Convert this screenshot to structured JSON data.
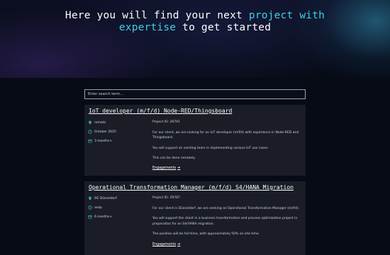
{
  "hero": {
    "title_part1": "Here you will find your next ",
    "title_highlight1": "project with",
    "title_highlight2": "expertise",
    "title_part2": " to get started"
  },
  "search": {
    "placeholder": "Enter search term..."
  },
  "colors": {
    "accent": "#3fd0e6",
    "card_bg": "#1a1d26",
    "page_bg": "#070b16"
  },
  "jobs": [
    {
      "title": "IoT developer (m/f/d) Node-RED/Thingsboard",
      "location": "remote",
      "start": "October 2025",
      "duration": "3 months+",
      "project_id": "Project ID: 29791",
      "paragraphs": [
        "For our client, we are looking for an IoT developer (m/f/d) with experience in Node-RED and Thingsboard.",
        "You will support an existing team in implementing various IoT use cases.",
        "This can be done remotely."
      ],
      "apply_label": "Engagements",
      "icons": {
        "location": "pin-icon",
        "start": "clock-icon",
        "duration": "calendar-icon"
      }
    },
    {
      "title": "Operational Transformation Manager (m/f/d) S4/HANA Migration",
      "location": "DE Düsseldorf",
      "start": "asap",
      "duration": "6 months+",
      "project_id": "Project ID: 29787",
      "paragraphs": [
        "For our client in Düsseldorf, we are seeking an Operational Transformation Manager (m/f/d).",
        "You will support the client in a business transformation and process optimization project in preparation for an S4/HANA migration.",
        "The position will be full-time, with approximately 50% on-site time."
      ],
      "apply_label": "Engagements",
      "icons": {
        "location": "pin-icon",
        "start": "clock-icon",
        "duration": "calendar-icon"
      }
    }
  ]
}
